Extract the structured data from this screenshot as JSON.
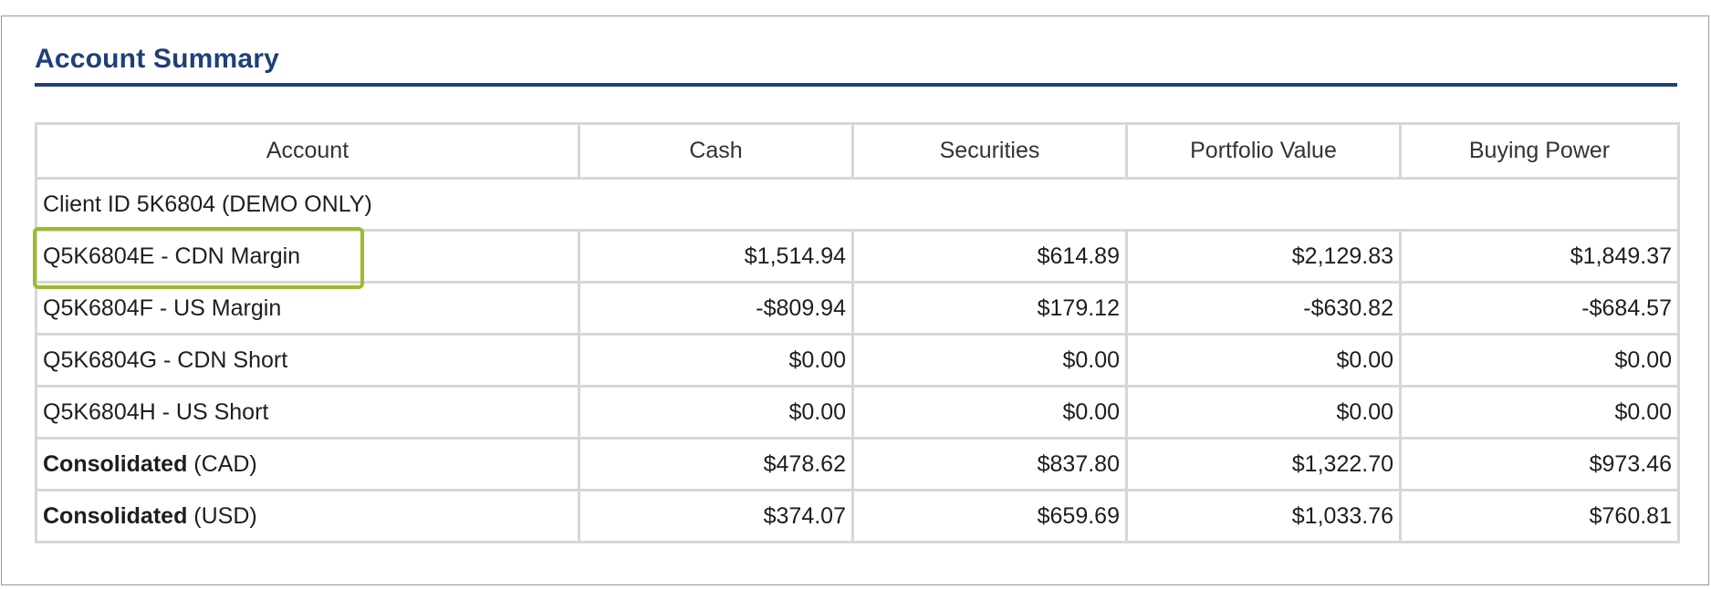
{
  "panel": {
    "title": "Account Summary"
  },
  "table": {
    "headers": [
      "Account",
      "Cash",
      "Securities",
      "Portfolio Value",
      "Buying Power"
    ],
    "client_row": "Client ID 5K6804 (DEMO ONLY)",
    "rows": [
      {
        "account": "Q5K6804E - CDN Margin",
        "cash": "$1,514.94",
        "securities": "$614.89",
        "portfolio_value": "$2,129.83",
        "buying_power": "$1,849.37"
      },
      {
        "account": "Q5K6804F - US Margin",
        "cash": "-$809.94",
        "securities": "$179.12",
        "portfolio_value": "-$630.82",
        "buying_power": "-$684.57"
      },
      {
        "account": "Q5K6804G - CDN Short",
        "cash": "$0.00",
        "securities": "$0.00",
        "portfolio_value": "$0.00",
        "buying_power": "$0.00"
      },
      {
        "account": "Q5K6804H - US Short",
        "cash": "$0.00",
        "securities": "$0.00",
        "portfolio_value": "$0.00",
        "buying_power": "$0.00"
      }
    ],
    "consolidated": [
      {
        "label_bold": "Consolidated",
        "label_rest": " (CAD)",
        "cash": "$478.62",
        "securities": "$837.80",
        "portfolio_value": "$1,322.70",
        "buying_power": "$973.46"
      },
      {
        "label_bold": "Consolidated",
        "label_rest": " (USD)",
        "cash": "$374.07",
        "securities": "$659.69",
        "portfolio_value": "$1,033.76",
        "buying_power": "$760.81"
      }
    ]
  },
  "colors": {
    "title": "#1f3f7a",
    "negative": "#e31b23",
    "highlight": "#9bbc2a",
    "grid": "#d7d7d7"
  }
}
